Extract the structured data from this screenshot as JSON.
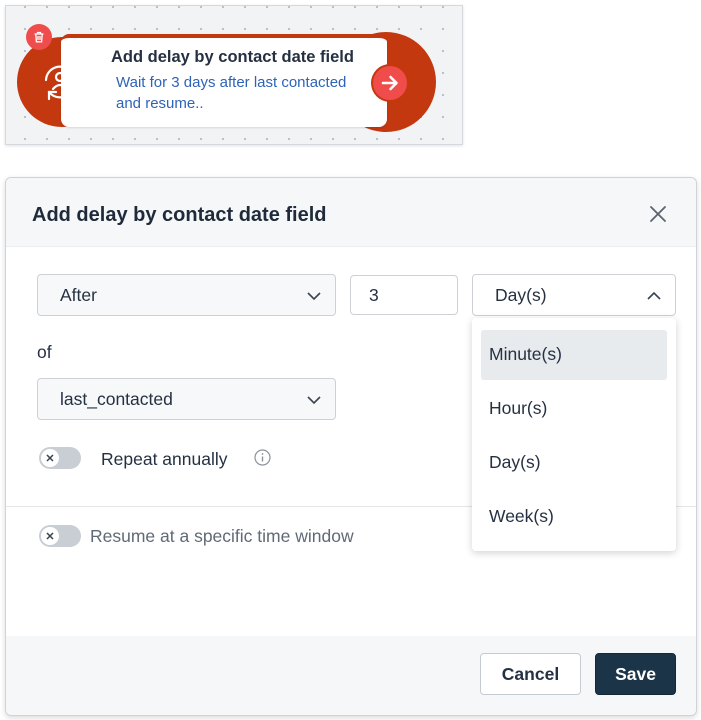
{
  "node": {
    "title": "Add delay by contact date field",
    "description": "Wait for 3 days after last contacted and resume..",
    "icon": "contact-sync-icon",
    "delete_icon": "trash-icon",
    "next_icon": "arrow-right-icon",
    "accent_color": "#c4380f"
  },
  "modal": {
    "title": "Add delay by contact date field",
    "timing_select": {
      "value": "After"
    },
    "amount_input": {
      "value": "3"
    },
    "unit_select": {
      "value": "Day(s)",
      "options": [
        "Minute(s)",
        "Hour(s)",
        "Day(s)",
        "Week(s)"
      ],
      "highlighted": "Minute(s)"
    },
    "of_label": "of",
    "field_select": {
      "value": "last_contacted"
    },
    "repeat_annually": {
      "label": "Repeat annually",
      "enabled": false
    },
    "resume_window": {
      "label": "Resume at a specific time window",
      "enabled": false
    },
    "footer": {
      "cancel_label": "Cancel",
      "save_label": "Save"
    },
    "save_color": "#1b3448"
  }
}
